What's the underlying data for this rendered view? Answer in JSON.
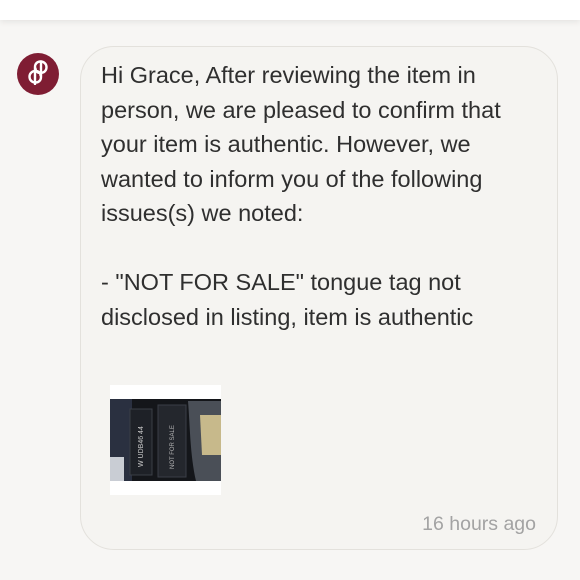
{
  "message": {
    "text": "Hi Grace, After reviewing the item in person, we are pleased to confirm that your item is authentic. However, we wanted to inform you of the following issues(s) we noted:\n\n- \"NOT FOR SALE\" tongue tag not disclosed in listing, item is authentic",
    "timestamp": "16 hours ago",
    "attachment": {
      "label_a": "W UDB46 44",
      "label_b": "NOT FOR SALE"
    }
  },
  "colors": {
    "avatar": "#7f1d33",
    "bubble_background": "#f5f4f1",
    "text": "#2f2f2f",
    "timestamp": "#a3a3a3"
  },
  "icons": {
    "avatar": "poshmark-logo-icon"
  }
}
